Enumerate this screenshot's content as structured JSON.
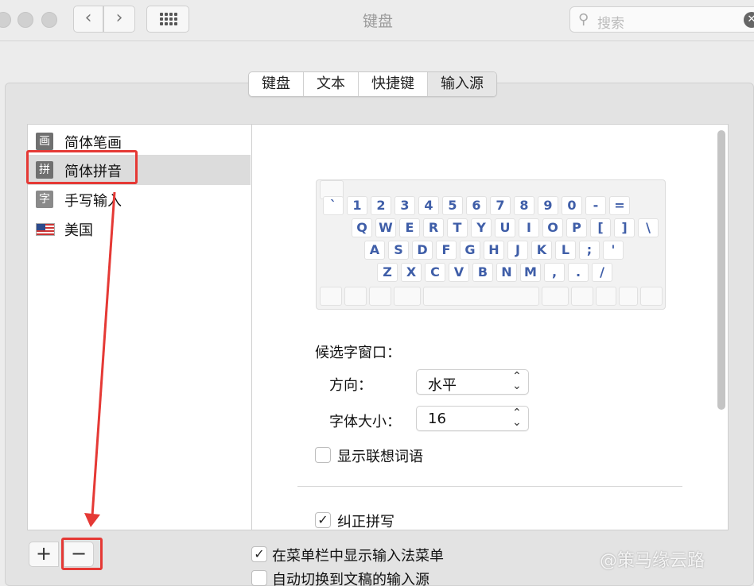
{
  "window": {
    "title": "键盘"
  },
  "search": {
    "placeholder": "搜索"
  },
  "tabs": [
    {
      "label": "键盘",
      "active": false
    },
    {
      "label": "文本",
      "active": false
    },
    {
      "label": "快捷键",
      "active": false
    },
    {
      "label": "输入源",
      "active": true
    }
  ],
  "sources": [
    {
      "label": "简体笔画",
      "icon": "画"
    },
    {
      "label": "简体拼音",
      "icon": "拼",
      "selected": true
    },
    {
      "label": "手写输入",
      "icon": "字"
    },
    {
      "label": "美国",
      "icon": "us-flag-icon"
    }
  ],
  "keyboard": {
    "row1": [
      "`",
      "1",
      "2",
      "3",
      "4",
      "5",
      "6",
      "7",
      "8",
      "9",
      "0",
      "-",
      "="
    ],
    "row2": [
      "Q",
      "W",
      "E",
      "R",
      "T",
      "Y",
      "U",
      "I",
      "O",
      "P",
      "[",
      "]",
      "\\"
    ],
    "row3": [
      "A",
      "S",
      "D",
      "F",
      "G",
      "H",
      "J",
      "K",
      "L",
      ";",
      "'"
    ],
    "row4": [
      "Z",
      "X",
      "C",
      "V",
      "B",
      "N",
      "M",
      ",",
      ".",
      "/"
    ]
  },
  "candidate": {
    "heading": "候选字窗口：",
    "direction_label": "方向：",
    "direction_value": "水平",
    "fontsize_label": "字体大小：",
    "fontsize_value": "16",
    "show_assoc_label": "显示联想词语",
    "show_assoc_checked": false,
    "autocorrect_label": "纠正拼写",
    "autocorrect_checked": true
  },
  "bottom": {
    "add_label": "+",
    "remove_label": "−",
    "show_menu_label": "在菜单栏中显示输入法菜单",
    "show_menu_checked": true,
    "auto_switch_label": "自动切换到文稿的输入源",
    "auto_switch_checked": false
  },
  "watermark": "@策马缘云路",
  "colors": {
    "highlight": "#e53935",
    "key_text": "#3f5ea8",
    "selected_row": "#dcdcdc"
  }
}
